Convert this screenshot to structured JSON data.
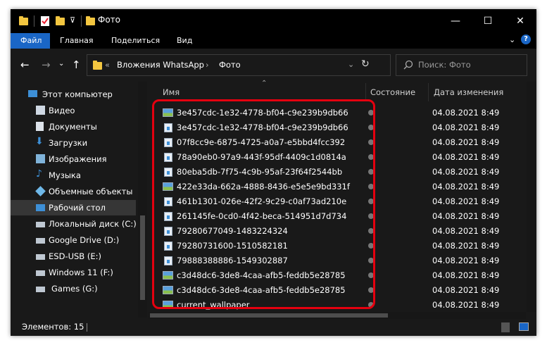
{
  "window": {
    "title": "Фото"
  },
  "ribbon": {
    "tabs": [
      "Файл",
      "Главная",
      "Поделиться",
      "Вид"
    ]
  },
  "address": {
    "sep": "«",
    "crumbs": [
      "Вложения WhatsApp",
      "Фото"
    ]
  },
  "search": {
    "placeholder": "Поиск: Фото"
  },
  "nav": {
    "items": [
      {
        "label": "Этот компьютер",
        "icon": "computer-icon"
      },
      {
        "label": "Видео",
        "icon": "video-icon"
      },
      {
        "label": "Документы",
        "icon": "documents-icon"
      },
      {
        "label": "Загрузки",
        "icon": "downloads-icon"
      },
      {
        "label": "Изображения",
        "icon": "pictures-icon"
      },
      {
        "label": "Музыка",
        "icon": "music-icon"
      },
      {
        "label": "Объемные объекты",
        "icon": "3d-objects-icon"
      },
      {
        "label": "Рабочий стол",
        "icon": "desktop-icon"
      },
      {
        "label": "Локальный диск (C:)",
        "icon": "drive-icon"
      },
      {
        "label": "Google Drive (D:)",
        "icon": "drive-icon"
      },
      {
        "label": "ESD-USB (E:)",
        "icon": "drive-icon"
      },
      {
        "label": "Windows 11 (F:)",
        "icon": "drive-icon"
      },
      {
        "label": "Games (G:)",
        "icon": "drive-icon"
      }
    ]
  },
  "list": {
    "columns": [
      "Имя",
      "Состояние",
      "Дата изменения"
    ],
    "files": [
      {
        "name": "3e457cdc-1e32-4778-bf04-c9e239b9db66",
        "date": "04.08.2021 8:49",
        "icon": "image-file-icon"
      },
      {
        "name": "3e457cdc-1e32-4778-bf04-c9e239b9db66",
        "date": "04.08.2021 8:49",
        "icon": "file-icon"
      },
      {
        "name": "07f8cc9e-6875-4725-a0a7-e5bbd4fcc392",
        "date": "04.08.2021 8:49",
        "icon": "file-icon"
      },
      {
        "name": "78a90eb0-97a9-443f-95df-4409c1d0814a",
        "date": "04.08.2021 8:49",
        "icon": "file-icon"
      },
      {
        "name": "80eba5db-7f75-4c9b-95af-23f64f2544bb",
        "date": "04.08.2021 8:49",
        "icon": "file-icon"
      },
      {
        "name": "422e33da-662a-4888-8436-e5e5e9bd331f",
        "date": "04.08.2021 8:49",
        "icon": "image-file-icon"
      },
      {
        "name": "461b1301-026e-42f2-9c29-c0af73ad210e",
        "date": "04.08.2021 8:49",
        "icon": "file-icon"
      },
      {
        "name": "261145fe-0cd0-4f42-beca-514951d7d734",
        "date": "04.08.2021 8:49",
        "icon": "file-icon"
      },
      {
        "name": "79280677049-1483224324",
        "date": "04.08.2021 8:49",
        "icon": "file-icon"
      },
      {
        "name": "79280731600-1510582181",
        "date": "04.08.2021 8:49",
        "icon": "file-icon"
      },
      {
        "name": "79888388886-1549302887",
        "date": "04.08.2021 8:49",
        "icon": "file-icon"
      },
      {
        "name": "c3d48dc6-3de8-4caa-afb5-feddb5e28785",
        "date": "04.08.2021 8:49",
        "icon": "image-file-icon"
      },
      {
        "name": "c3d48dc6-3de8-4caa-afb5-feddb5e28785",
        "date": "04.08.2021 8:49",
        "icon": "image-file-icon"
      },
      {
        "name": "current_wallpaper",
        "date": "04.08.2021 8:49",
        "icon": "image-file-icon"
      }
    ]
  },
  "status": {
    "text": "Элементов: 15"
  },
  "colors": {
    "accent": "#1a66c6",
    "highlight": "#e5000f",
    "folder": "#f3c640"
  }
}
